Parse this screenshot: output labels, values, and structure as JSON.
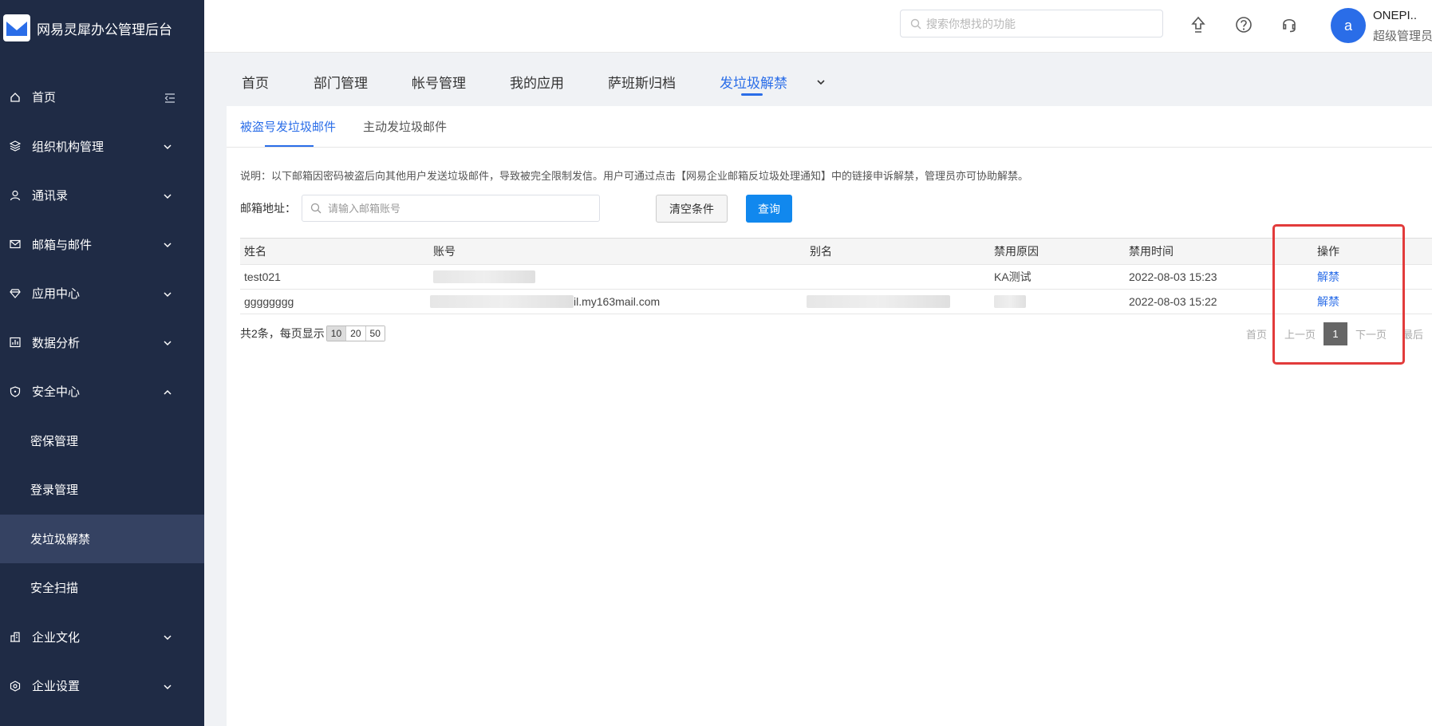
{
  "app": {
    "title": "网易灵犀办公管理后台"
  },
  "sidebar": {
    "items": [
      {
        "label": "首页",
        "icon": "home-icon"
      },
      {
        "label": "组织机构管理",
        "icon": "layers-icon"
      },
      {
        "label": "通讯录",
        "icon": "user-icon"
      },
      {
        "label": "邮箱与邮件",
        "icon": "mail-icon"
      },
      {
        "label": "应用中心",
        "icon": "diamond-icon"
      },
      {
        "label": "数据分析",
        "icon": "chart-icon"
      },
      {
        "label": "安全中心",
        "icon": "shield-icon"
      },
      {
        "label": "密保管理"
      },
      {
        "label": "登录管理"
      },
      {
        "label": "发垃圾解禁"
      },
      {
        "label": "安全扫描"
      },
      {
        "label": "企业文化",
        "icon": "building-icon"
      },
      {
        "label": "企业设置",
        "icon": "settings-icon"
      }
    ]
  },
  "header": {
    "search_placeholder": "搜索你想找的功能",
    "avatar_letter": "a",
    "user_name": "ONEPI..",
    "user_role": "超级管理员"
  },
  "tabs": [
    "首页",
    "部门管理",
    "帐号管理",
    "我的应用",
    "萨班斯归档",
    "发垃圾解禁"
  ],
  "subtabs": [
    "被盗号发垃圾邮件",
    "主动发垃圾邮件"
  ],
  "note": "说明：以下邮箱因密码被盗后向其他用户发送垃圾邮件，导致被完全限制发信。用户可通过点击【网易企业邮箱反垃圾处理通知】中的链接申诉解禁，管理员亦可协助解禁。",
  "filter": {
    "label": "邮箱地址：",
    "placeholder": "请输入邮箱账号",
    "clear_label": "清空条件",
    "query_label": "查询"
  },
  "table": {
    "columns": [
      "姓名",
      "账号",
      "别名",
      "禁用原因",
      "禁用时间",
      "操作"
    ],
    "rows": [
      {
        "name": "test021",
        "account": "",
        "alias": "",
        "reason": "KA测试",
        "time": "2022-08-03 15:23",
        "action": "解禁"
      },
      {
        "name": "gggggggg",
        "account": "il.my163mail.com",
        "alias": "",
        "reason": "",
        "time": "2022-08-03 15:22",
        "action": "解禁"
      }
    ]
  },
  "pagination": {
    "summary": "共2条，每页显示",
    "sizes": [
      "10",
      "20",
      "50"
    ],
    "first": "首页",
    "prev": "上一页",
    "current": "1",
    "next": "下一页",
    "last": "最后"
  },
  "colors": {
    "sidebar": "#1f2b45",
    "accent": "#2a6de8",
    "query_button": "#1188ee",
    "highlight": "#e23b3b"
  }
}
